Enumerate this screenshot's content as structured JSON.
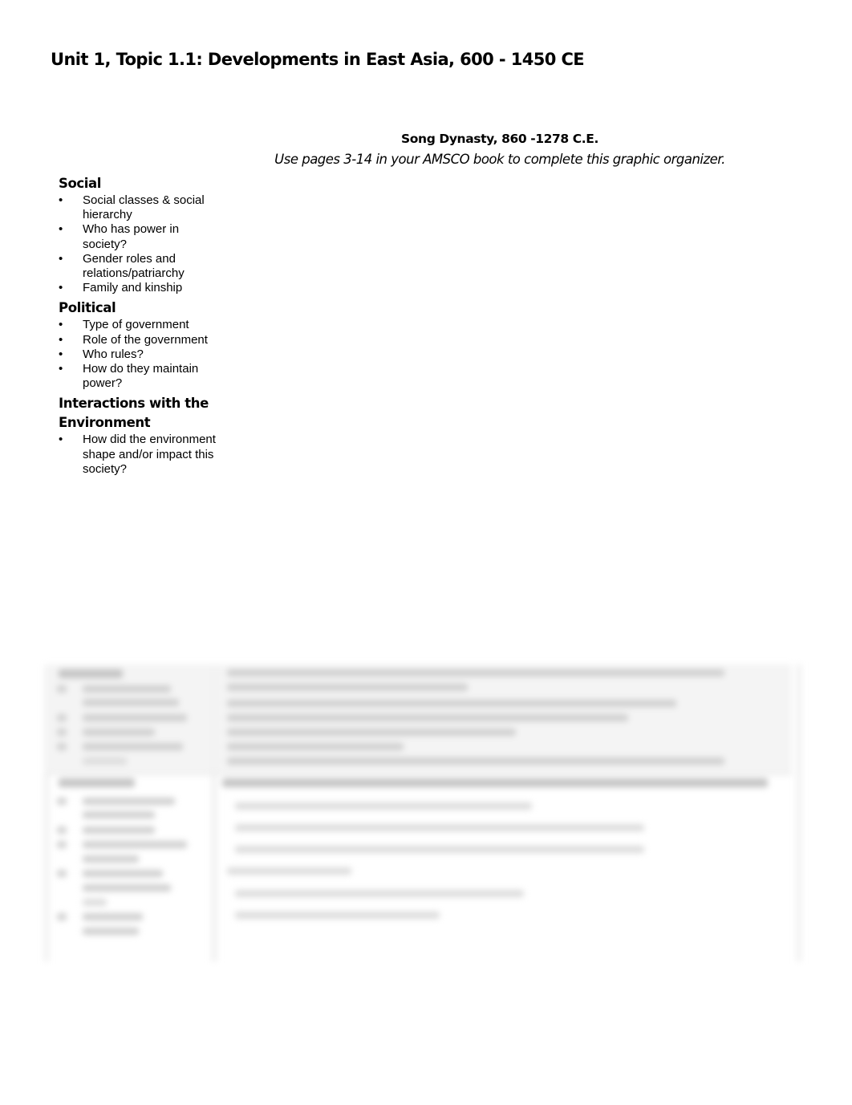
{
  "page": {
    "title": "Unit 1, Topic 1.1: Developments in East Asia,  600 - 1450 CE",
    "subtitle": "Song Dynasty, 860 -1278 C.E.",
    "instructions": "Use pages 3-14 in your AMSCO book to complete this graphic organizer."
  },
  "sections": [
    {
      "heading": "Social",
      "items": [
        "Social classes & social hierarchy",
        "Who has power in society?",
        "Gender roles and relations/patriarchy",
        "Family and kinship"
      ]
    },
    {
      "heading": "Political",
      "items": [
        "Type of government",
        "Role of the government",
        "Who rules?",
        "How do they maintain power?"
      ]
    },
    {
      "heading": "Interactions with the Environment",
      "items": [
        "How did the environment shape and/or impact this society?"
      ]
    }
  ],
  "blurred_preview": {
    "state": "blurred",
    "readable_text": false
  }
}
